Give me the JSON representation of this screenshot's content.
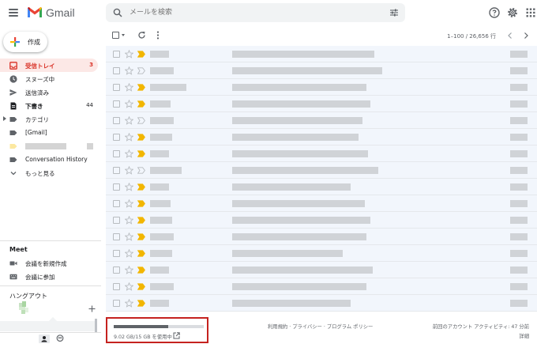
{
  "app": {
    "brand": "Gmail"
  },
  "search": {
    "placeholder": "メールを検索"
  },
  "compose": {
    "label": "作成"
  },
  "nav": {
    "items": [
      {
        "label": "受信トレイ",
        "count": "3"
      },
      {
        "label": "スヌーズ中"
      },
      {
        "label": "送信済み"
      },
      {
        "label": "下書き",
        "count": "44"
      },
      {
        "label": "カテゴリ"
      },
      {
        "label": "[Gmail]"
      },
      {
        "label": "Conversation History"
      },
      {
        "label": "もっと見る"
      }
    ]
  },
  "meet": {
    "title": "Meet",
    "new_meeting": "会議を新規作成",
    "join_meeting": "会議に参加"
  },
  "hangouts": {
    "title": "ハングアウト"
  },
  "toolbar": {
    "range": "1–100 / 26,656 行"
  },
  "storage": {
    "text": "9.02 GB/15 GB を使用中",
    "fraction": 0.601
  },
  "footer": {
    "links": "利用規約 · プライバシー · プログラム ポリシー",
    "activity": "前回のアカウント アクティビティ: 47 分前",
    "details": "詳細"
  },
  "colors": {
    "accent": "#d93025",
    "important": "#f2b600",
    "highlight": "#c5221f"
  }
}
